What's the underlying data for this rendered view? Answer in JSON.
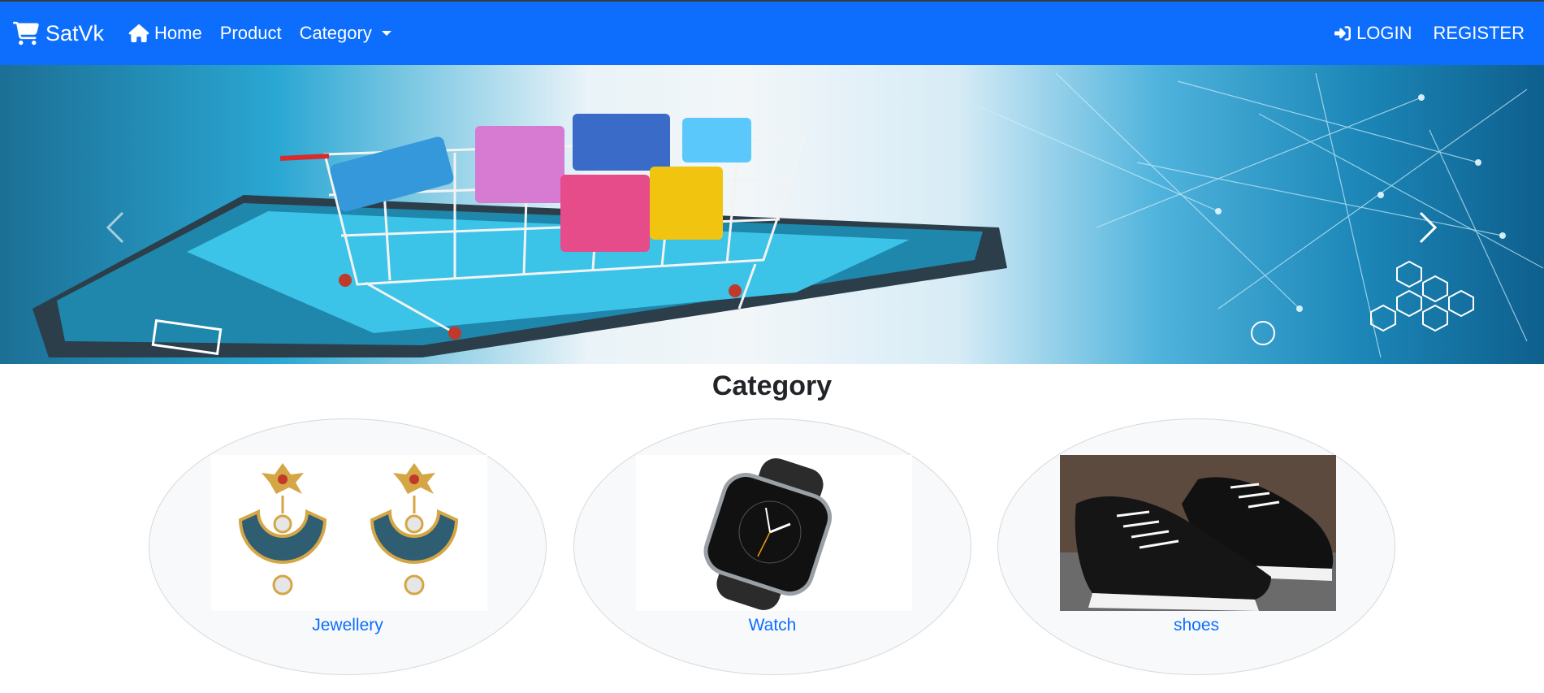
{
  "navbar": {
    "brand": "SatVk",
    "links": {
      "home": "Home",
      "product": "Product",
      "category": "Category"
    },
    "login": "LOGIN",
    "register": "REGISTER",
    "colors": {
      "background": "#0d6efd",
      "text": "#ffffff"
    }
  },
  "carousel": {
    "prev_icon": "chevron-left-icon",
    "next_icon": "chevron-right-icon"
  },
  "categories_section": {
    "title": "Category",
    "items": [
      {
        "label": "Jewellery",
        "icon": "earrings-image"
      },
      {
        "label": "Watch",
        "icon": "smartwatch-image"
      },
      {
        "label": "shoes",
        "icon": "sneakers-image"
      }
    ],
    "link_color": "#0d6efd"
  }
}
